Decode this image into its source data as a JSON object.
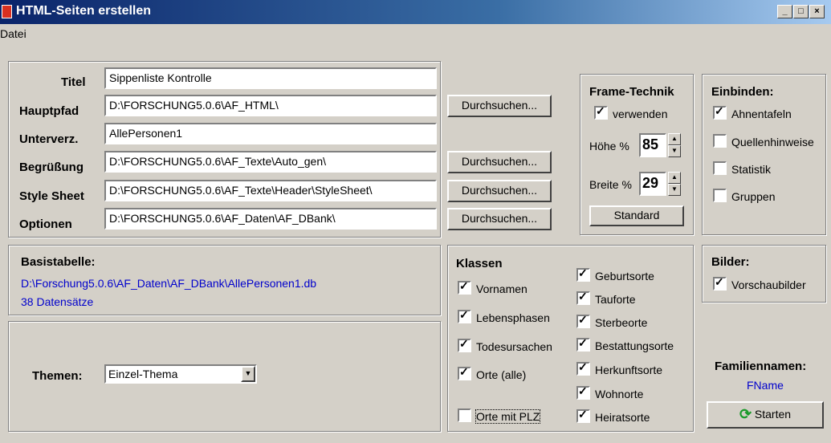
{
  "window": {
    "title": "HTML-Seiten erstellen"
  },
  "menu": {
    "file": "Datei"
  },
  "paths": {
    "titel_label": "Titel",
    "titel_value": "Sippenliste Kontrolle",
    "hauptpfad_label": "Hauptpfad",
    "hauptpfad_value": "D:\\FORSCHUNG5.0.6\\AF_HTML\\",
    "unterverz_label": "Unterverz.",
    "unterverz_value": "AllePersonen1",
    "begruessung_label": "Begrüßung",
    "begruessung_value": "D:\\FORSCHUNG5.0.6\\AF_Texte\\Auto_gen\\",
    "stylesheet_label": "Style Sheet",
    "stylesheet_value": "D:\\FORSCHUNG5.0.6\\AF_Texte\\Header\\StyleSheet\\",
    "optionen_label": "Optionen",
    "optionen_value": "D:\\FORSCHUNG5.0.6\\AF_Daten\\AF_DBank\\",
    "browse_label": "Durchsuchen..."
  },
  "frame": {
    "title": "Frame-Technik",
    "use_label": "verwenden",
    "hoehe_label": "Höhe %",
    "hoehe_value": "85",
    "breite_label": "Breite %",
    "breite_value": "29",
    "standard_label": "Standard"
  },
  "einbinden": {
    "title": "Einbinden:",
    "items": [
      "Ahnentafeln",
      "Quellenhinweise",
      "Statistik",
      "Gruppen"
    ]
  },
  "basis": {
    "title": "Basistabelle:",
    "path": "D:\\Forschung5.0.6\\AF_Daten\\AF_DBank\\AllePersonen1.db",
    "count": "38 Datensätze"
  },
  "themen": {
    "label": "Themen:",
    "value": "Einzel-Thema"
  },
  "klassen": {
    "title": "Klassen",
    "left": [
      "Vornamen",
      "Lebensphasen",
      "Todesursachen",
      "Orte (alle)",
      "Orte mit PLZ"
    ],
    "right": [
      "Geburtsorte",
      "Tauforte",
      "Sterbeorte",
      "Bestattungsorte",
      "Herkunftsorte",
      "Wohnorte",
      "Heiratsorte"
    ]
  },
  "bilder": {
    "title": "Bilder:",
    "item": "Vorschaubilder"
  },
  "familien": {
    "label": "Familiennamen:",
    "value": "FName",
    "start_label": "Starten"
  },
  "colors": {
    "link_blue": "#0000cc",
    "title_start": "#0a246a",
    "title_end": "#a6caf0"
  }
}
